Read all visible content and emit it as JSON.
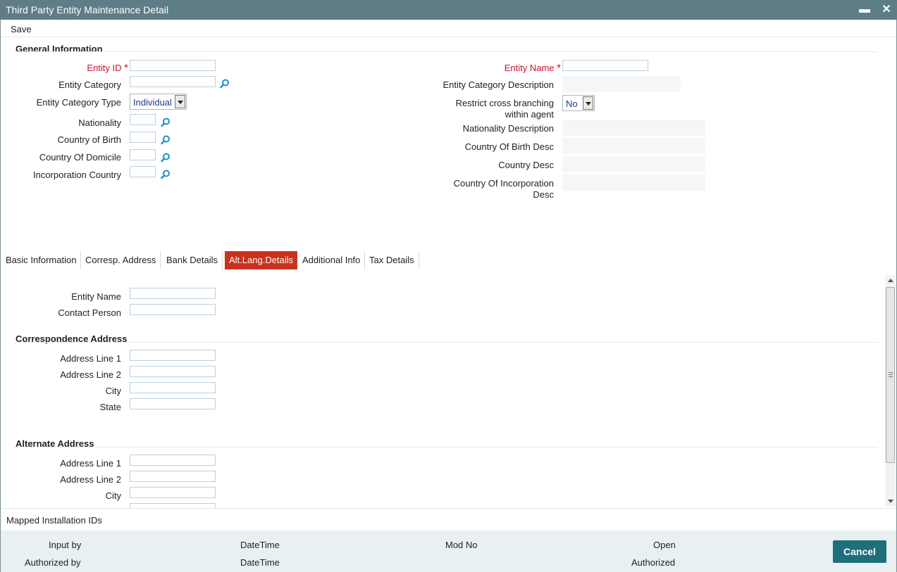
{
  "window": {
    "title": "Third Party Entity Maintenance Detail"
  },
  "toolbar": {
    "save_label": "Save"
  },
  "general": {
    "section_title": "General Information",
    "entity_id_label": "Entity ID",
    "entity_id_value": "",
    "entity_category_label": "Entity Category",
    "entity_category_value": "",
    "entity_category_type_label": "Entity Category Type",
    "entity_category_type_value": "Individual",
    "nationality_label": "Nationality",
    "country_of_birth_label": "Country of Birth",
    "country_of_domicile_label": "Country Of Domicile",
    "incorporation_country_label": "Incorporation Country",
    "entity_name_label": "Entity Name",
    "entity_name_value": "",
    "entity_category_desc_label": "Entity Category Description",
    "restrict_label_line1": "Restrict cross branching",
    "restrict_label_line2": "within agent",
    "restrict_value": "No",
    "nationality_desc_label": "Nationality Description",
    "country_of_birth_desc_label": "Country Of Birth Desc",
    "country_desc_label": "Country Desc",
    "country_incorp_desc_line1": "Country Of Incorporation",
    "country_incorp_desc_line2": "Desc"
  },
  "tabs": [
    {
      "label": "Basic Information",
      "active": false
    },
    {
      "label": "Corresp. Address",
      "active": false
    },
    {
      "label": "Bank Details",
      "active": false
    },
    {
      "label": "Alt.Lang.Details",
      "active": true
    },
    {
      "label": "Additional Info",
      "active": false
    },
    {
      "label": "Tax Details",
      "active": false
    }
  ],
  "alt_lang": {
    "entity_name_label": "Entity Name",
    "contact_person_label": "Contact Person",
    "correspondence_title": "Correspondence Address",
    "corr_address_line1_label": "Address Line 1",
    "corr_address_line2_label": "Address Line 2",
    "corr_city_label": "City",
    "corr_state_label": "State",
    "alternate_title": "Alternate Address",
    "alt_address_line1_label": "Address Line 1",
    "alt_address_line2_label": "Address Line 2",
    "alt_city_label": "City"
  },
  "mapped": {
    "label": "Mapped Installation IDs"
  },
  "footer": {
    "input_by": "Input by",
    "authorized_by": "Authorized by",
    "datetime1": "DateTime",
    "datetime2": "DateTime",
    "mod_no": "Mod No",
    "open": "Open",
    "authorized": "Authorized",
    "cancel_label": "Cancel"
  },
  "colors": {
    "titlebar": "#5f7d86",
    "required": "#c8102e",
    "active_tab": "#c8321e",
    "cancel_button": "#1e6f7c",
    "footer_bg": "#e8f0f2",
    "lookup_icon": "#1f8fc9"
  },
  "icons": {
    "minimize": "minimize-icon",
    "close": "close-icon",
    "lookup": "search-icon"
  }
}
